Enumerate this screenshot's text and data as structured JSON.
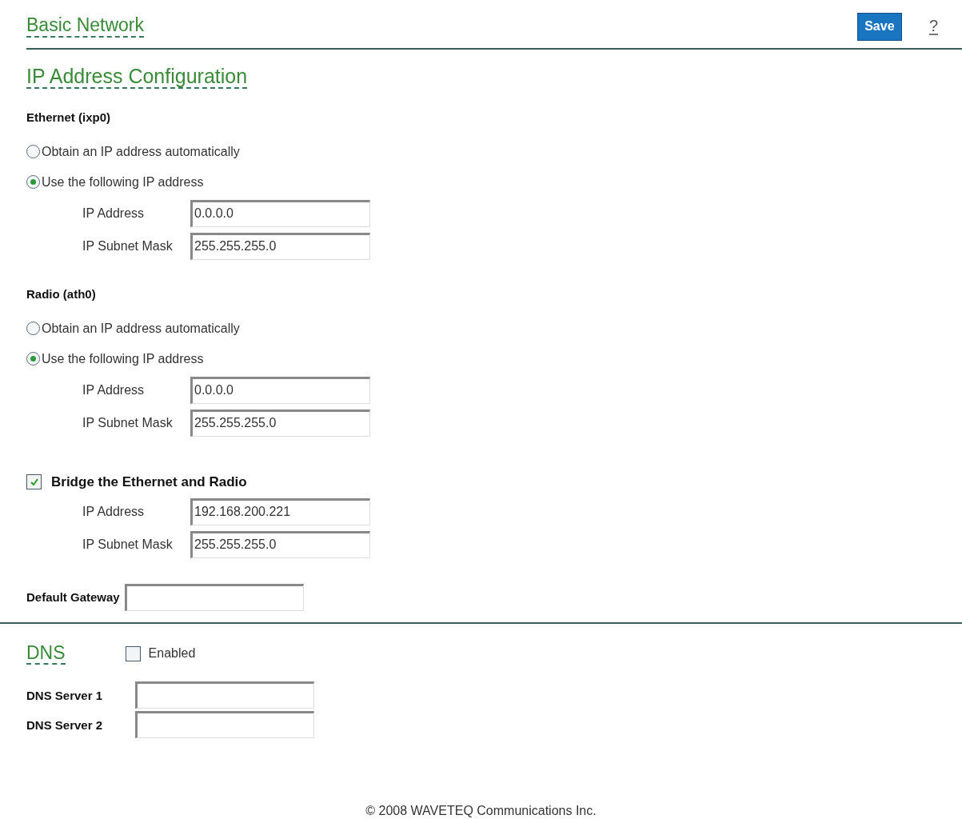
{
  "page_title": "Basic Network",
  "save_button": "Save",
  "help_link": "?",
  "section_title": "IP Address Configuration",
  "interfaces": [
    {
      "name": "Ethernet (ixp0)",
      "options": [
        {
          "label": "Obtain an IP address automatically",
          "selected": false
        },
        {
          "label": "Use the following IP address",
          "selected": true
        }
      ],
      "fields": [
        {
          "label": "IP Address",
          "value": "0.0.0.0"
        },
        {
          "label": "IP Subnet Mask",
          "value": "255.255.255.0"
        }
      ]
    },
    {
      "name": "Radio (ath0)",
      "options": [
        {
          "label": "Obtain an IP address automatically",
          "selected": false
        },
        {
          "label": "Use the following IP address",
          "selected": true
        }
      ],
      "fields": [
        {
          "label": "IP Address",
          "value": "0.0.0.0"
        },
        {
          "label": "IP Subnet Mask",
          "value": "255.255.255.0"
        }
      ]
    }
  ],
  "bridge": {
    "label": "Bridge the Ethernet and Radio",
    "checked": true,
    "fields": [
      {
        "label": "IP Address",
        "value": "192.168.200.221"
      },
      {
        "label": "IP Subnet Mask",
        "value": "255.255.255.0"
      }
    ]
  },
  "default_gateway": {
    "label": "Default Gateway"
  },
  "dns": {
    "title": "DNS",
    "enabled_label": "Enabled",
    "checked": false,
    "servers": [
      {
        "label": "DNS Server 1"
      },
      {
        "label": "DNS Server 2"
      }
    ]
  },
  "footer": "© 2008 WAVETEQ Communications Inc."
}
